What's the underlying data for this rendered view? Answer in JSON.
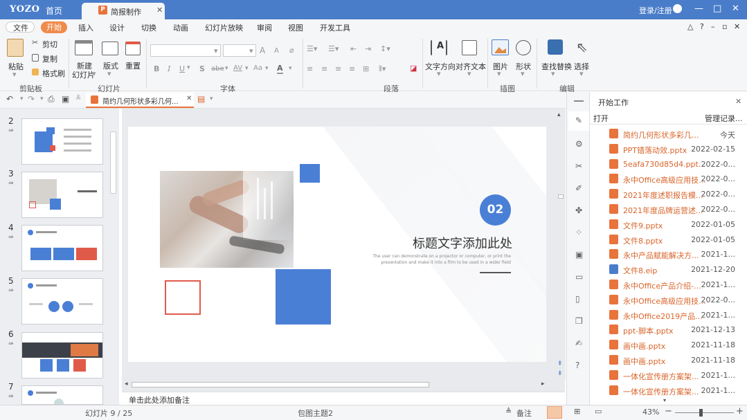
{
  "titlebar": {
    "logo": "YOZO",
    "home": "首页",
    "doc_tab": "简报制作",
    "login": "登录/注册",
    "win_controls": [
      "—",
      "□",
      "✕"
    ]
  },
  "menubar": {
    "items": [
      "文件",
      "开始",
      "插入",
      "设计",
      "切换",
      "动画",
      "幻灯片放映",
      "审阅",
      "视图",
      "开发工具"
    ],
    "right_icons": [
      "triangle-up-icon",
      "help-icon",
      "minimize-icon",
      "restore-icon",
      "close-icon"
    ]
  },
  "ribbon": {
    "clipboard": {
      "paste": "粘贴",
      "cut": "剪切",
      "copy": "复制",
      "format_painter": "格式刷",
      "group": "剪贴板"
    },
    "slides": {
      "new_slide_l1": "新建",
      "new_slide_l2": "幻灯片",
      "layout": "版式",
      "reset": "重置",
      "group": "幻灯片"
    },
    "font": {
      "bold": "B",
      "italic": "I",
      "underline": "U",
      "shadow": "S",
      "strike": "abe",
      "spacing": "AV",
      "case": "Aa",
      "color": "A",
      "grow": "A",
      "shrink": "A",
      "group": "字体"
    },
    "paragraph": {
      "group": "段落"
    },
    "text": {
      "direction": "文字方向",
      "align": "对齐文本"
    },
    "illustration": {
      "picture": "图片",
      "shape": "形状",
      "group": "插图"
    },
    "edit": {
      "find_replace": "查找替换",
      "select": "选择",
      "group": "编辑"
    }
  },
  "quickbar": {
    "doc_tab": "简约几何形状多彩几何..."
  },
  "thumbnails": [
    {
      "num": "2"
    },
    {
      "num": "3"
    },
    {
      "num": "4"
    },
    {
      "num": "5"
    },
    {
      "num": "6"
    },
    {
      "num": "7"
    }
  ],
  "slide": {
    "badge": "02",
    "title": "标题文字添加此处",
    "subtitle_line1": "The user can demonstrate on a projector or computer, or print the",
    "subtitle_line2": "presentation and make it into a film to be used in a wider field"
  },
  "notes_placeholder": "单击此处添加备注",
  "panel": {
    "title": "开始工作",
    "open": "打开",
    "manage": "管理记录...",
    "files": [
      {
        "name": "简约几何形状多彩几...",
        "date": "今天",
        "type": "ppt"
      },
      {
        "name": "PPT错落动效.pptx",
        "date": "2022-02-15",
        "type": "ppt"
      },
      {
        "name": "5eafa730d85d4.ppt...",
        "date": "2022-0...",
        "type": "ppt"
      },
      {
        "name": "永中Office高级应用技...",
        "date": "2022-0...",
        "type": "ppt"
      },
      {
        "name": "2021年度述职报告模...",
        "date": "2022-0...",
        "type": "ppt"
      },
      {
        "name": "2021年度品牌运营述...",
        "date": "2022-0...",
        "type": "ppt"
      },
      {
        "name": "文件9.pptx",
        "date": "2022-01-05",
        "type": "ppt"
      },
      {
        "name": "文件8.pptx",
        "date": "2022-01-05",
        "type": "ppt"
      },
      {
        "name": "永中产品赋能解决方...",
        "date": "2021-1...",
        "type": "ppt"
      },
      {
        "name": "文件8.eip",
        "date": "2021-12-20",
        "type": "eip"
      },
      {
        "name": "永中Office产品介绍-...",
        "date": "2021-1...",
        "type": "ppt"
      },
      {
        "name": "永中Office高级应用技...",
        "date": "2022-0...",
        "type": "ppt"
      },
      {
        "name": "永中Office2019产品...",
        "date": "2021-1...",
        "type": "ppt"
      },
      {
        "name": "ppt-脚本.pptx",
        "date": "2021-12-13",
        "type": "ppt"
      },
      {
        "name": "画中画.pptx",
        "date": "2021-11-18",
        "type": "ppt"
      },
      {
        "name": "画中画.pptx",
        "date": "2021-11-18",
        "type": "ppt"
      },
      {
        "name": "一体化宣传册方案架...",
        "date": "2021-1...",
        "type": "ppt"
      },
      {
        "name": "一体化宣传册方案架...",
        "date": "2021-1...",
        "type": "ppt"
      }
    ]
  },
  "status": {
    "slide_info": "幻灯片 9 / 25",
    "theme": "包图主题2",
    "notes_btn": "备注",
    "zoom": "43%"
  },
  "colors": {
    "accent_blue": "#4a7dc9",
    "accent_orange": "#f08a4b",
    "slide_blue": "#4a7fd6"
  }
}
